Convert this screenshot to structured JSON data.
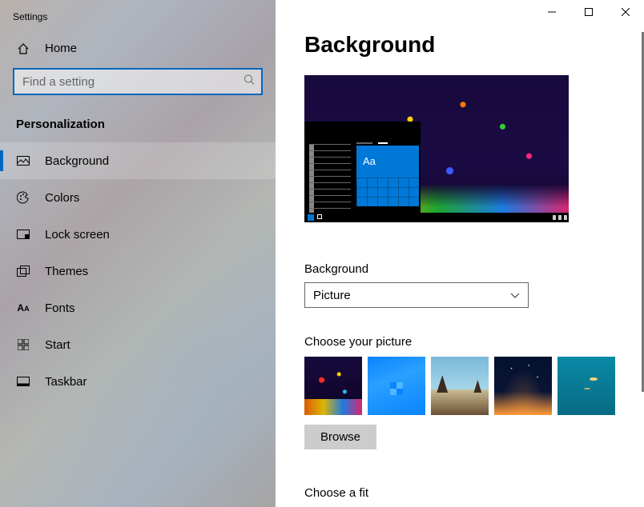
{
  "window_title": "Settings",
  "home_label": "Home",
  "search_placeholder": "Find a setting",
  "section_header": "Personalization",
  "nav": [
    {
      "label": "Background",
      "active": true
    },
    {
      "label": "Colors"
    },
    {
      "label": "Lock screen"
    },
    {
      "label": "Themes"
    },
    {
      "label": "Fonts"
    },
    {
      "label": "Start"
    },
    {
      "label": "Taskbar"
    }
  ],
  "page_title": "Background",
  "preview_sample_text": "Aa",
  "background_dropdown": {
    "label": "Background",
    "value": "Picture"
  },
  "choose_picture_label": "Choose your picture",
  "picture_thumbs": [
    "paint-splash",
    "windows-blue",
    "beach-rocks",
    "night-sky",
    "underwater"
  ],
  "browse_label": "Browse",
  "choose_fit_label": "Choose a fit",
  "titlebar": {
    "minimize": "minimize",
    "maximize": "maximize",
    "close": "close"
  }
}
